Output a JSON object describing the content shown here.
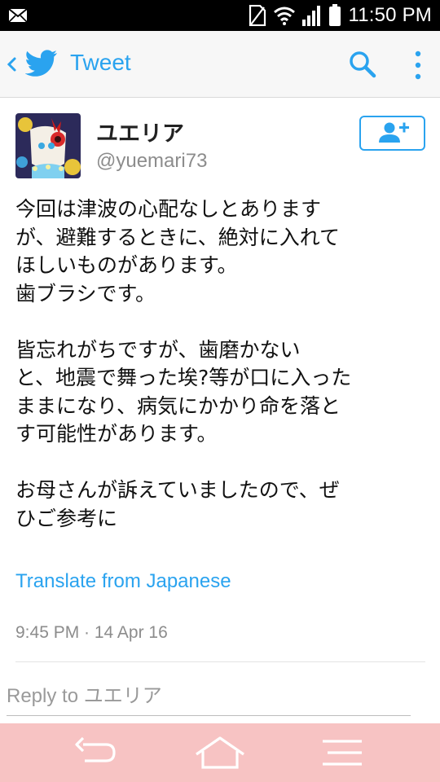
{
  "status_bar": {
    "time": "11:50 PM",
    "icons": [
      "mail-icon",
      "no-sim-icon",
      "wifi-icon",
      "signal-icon",
      "battery-icon"
    ]
  },
  "app_bar": {
    "title": "Tweet",
    "icons": [
      "back-chevron-icon",
      "twitter-bird-icon",
      "search-icon",
      "more-vert-icon"
    ],
    "accent_color": "#2aa3ef"
  },
  "tweet": {
    "author": {
      "name": "ユエリア",
      "handle": "@yuemari73"
    },
    "follow_button_icon": "add-user-icon",
    "text": "今回は津波の心配なしとあります\nが、避難するときに、絶対に入れて\nほしいものがあります。\n歯ブラシです。\n\n皆忘れがちですが、歯磨かない\nと、地震で舞った埃?等が口に入った\nままになり、病気にかかり命を落と\nす可能性があります。\n\nお母さんが訴えていましたので、ぜ\nひご参考に",
    "translate_link": "Translate from Japanese",
    "timestamp": "9:45 PM · 14 Apr 16"
  },
  "reply": {
    "placeholder": "Reply to ユエリア",
    "value": ""
  },
  "nav_bar": {
    "background": "#f7c3c3",
    "buttons": [
      "back-nav-icon",
      "home-nav-icon",
      "menu-nav-icon"
    ]
  }
}
